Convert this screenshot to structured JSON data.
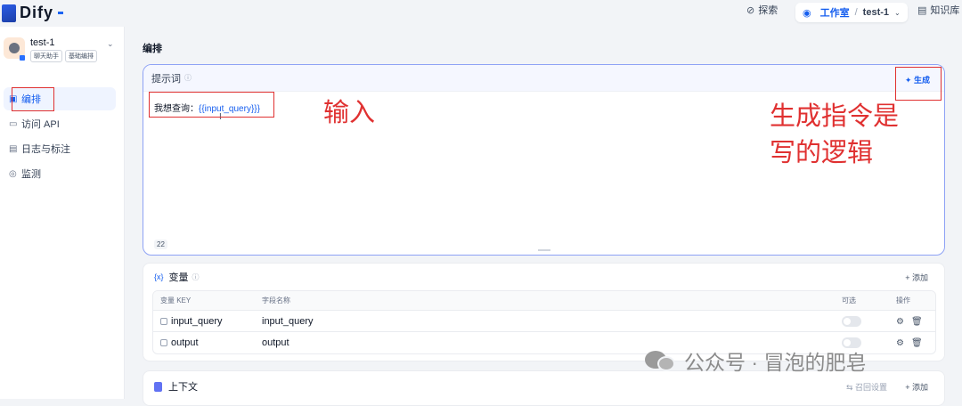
{
  "header": {
    "logo_text": "Dify",
    "nav": {
      "explore": "探索",
      "studio": "工作室",
      "separator": "/",
      "project": "test-1",
      "knowledge": "知识库"
    }
  },
  "sidebar": {
    "app_name": "test-1",
    "tags": [
      "聊天助手",
      "基础编排"
    ],
    "items": [
      {
        "label": "编排",
        "icon": "layout-icon",
        "active": true
      },
      {
        "label": "访问 API",
        "icon": "terminal-icon",
        "active": false
      },
      {
        "label": "日志与标注",
        "icon": "log-icon",
        "active": false
      },
      {
        "label": "监测",
        "icon": "monitor-icon",
        "active": false
      }
    ]
  },
  "main": {
    "title": "编排",
    "prompt": {
      "label": "提示词",
      "generate_label": "生成",
      "text_prefix": "我想查询：",
      "text_variable": "{{input_query}}}",
      "char_count": "22"
    },
    "variables": {
      "label": "变量",
      "add_label": "添加",
      "columns": [
        "变量 KEY",
        "字段名称",
        "可选",
        "操作"
      ],
      "rows": [
        {
          "key": "input_query",
          "name": "input_query",
          "optional": false
        },
        {
          "key": "output",
          "name": "output",
          "optional": false
        }
      ]
    },
    "context": {
      "label": "上下文",
      "recall_label": "召回设置",
      "add_label": "添加"
    }
  },
  "annotations": {
    "input_note": "输入",
    "generate_note_line1": "生成指令是",
    "generate_note_line2": "写的逻辑"
  },
  "watermark": {
    "text": "公众号 · 冒泡的肥皂"
  },
  "colors": {
    "accent": "#155eef",
    "annotation_red": "#e03131",
    "prompt_border": "#8ea2f5"
  }
}
